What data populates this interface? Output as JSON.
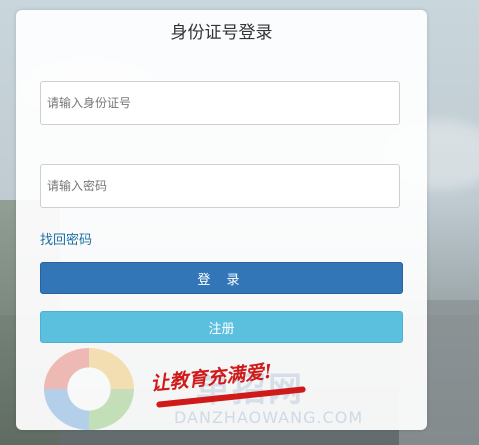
{
  "panel": {
    "title": "身份证号登录",
    "id_input": {
      "placeholder": "请输入身份证号",
      "value": ""
    },
    "password_input": {
      "placeholder": "请输入密码",
      "value": ""
    },
    "find_password_label": "找回密码",
    "login_label": "登 录",
    "register_label": "注册"
  },
  "watermark": {
    "slogan": "让教育充满爱!",
    "site_name": "单招网",
    "site_url": "DANZHAOWANG.COM"
  },
  "colors": {
    "login_button": "#3276b8",
    "register_button": "#5bc0de",
    "link": "#1f6fa6",
    "slogan": "#d01a1a"
  }
}
